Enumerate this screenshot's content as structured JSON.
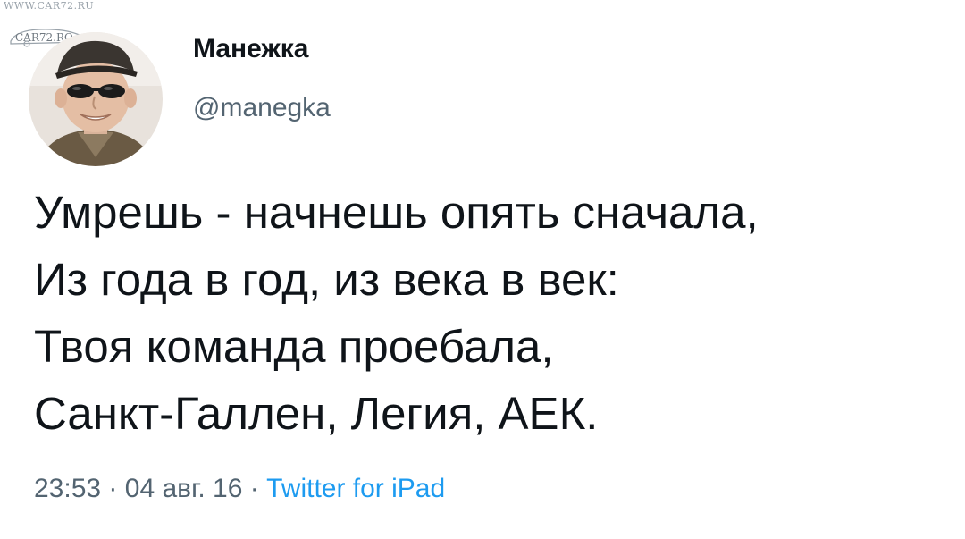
{
  "watermark": {
    "site": "WWW.CAR72.RU",
    "logo_text": "CAR72.RO"
  },
  "author": {
    "display_name": "Манежка",
    "handle": "@manegka"
  },
  "tweet": {
    "lines": [
      "Умрешь - начнешь опять сначала,",
      "Из года в год, из века в век:",
      "Твоя команда проебала,",
      "Санкт-Галлен, Легия, АЕК."
    ]
  },
  "meta": {
    "time": "23:53",
    "separator": "·",
    "date": "04 авг. 16",
    "source": "Twitter for iPad"
  },
  "colors": {
    "text": "#0f1419",
    "secondary": "#536471",
    "link": "#1d9bf0"
  }
}
